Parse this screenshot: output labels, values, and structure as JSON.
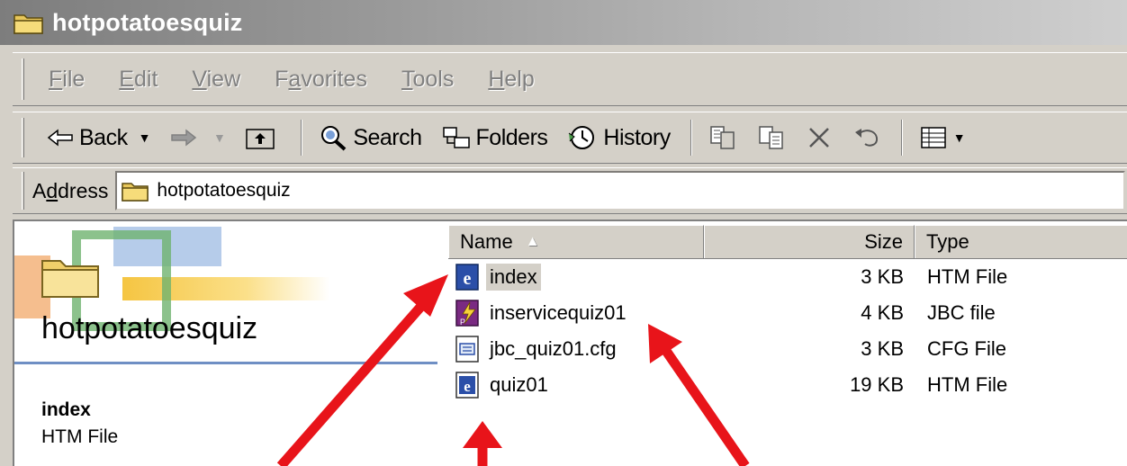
{
  "window": {
    "title": "hotpotatoesquiz"
  },
  "menu": {
    "items": [
      {
        "key": "F",
        "rest": "ile"
      },
      {
        "key": "E",
        "rest": "dit"
      },
      {
        "key": "V",
        "rest": "iew"
      },
      {
        "pre": "F",
        "key": "a",
        "rest": "vorites"
      },
      {
        "key": "T",
        "rest": "ools"
      },
      {
        "key": "H",
        "rest": "elp"
      }
    ]
  },
  "toolbar": {
    "back_label": "Back",
    "search_label": "Search",
    "folders_label": "Folders",
    "history_label": "History"
  },
  "address": {
    "label_pre": "A",
    "label_key": "d",
    "label_rest": "dress",
    "value": "hotpotatoesquiz"
  },
  "left_pane": {
    "folder_title": "hotpotatoesquiz",
    "selected_name": "index",
    "selected_type": "HTM File"
  },
  "file_list": {
    "columns": {
      "name": "Name",
      "size": "Size",
      "type": "Type"
    },
    "rows": [
      {
        "name": "index",
        "size": "3 KB",
        "type": "HTM File",
        "icon": "htm-file-icon"
      },
      {
        "name": "inservicequiz01",
        "size": "4 KB",
        "type": "JBC file",
        "icon": "jbc-file-icon"
      },
      {
        "name": "jbc_quiz01.cfg",
        "size": "3 KB",
        "type": "CFG File",
        "icon": "cfg-file-icon"
      },
      {
        "name": "quiz01",
        "size": "19 KB",
        "type": "HTM File",
        "icon": "htm-file-icon"
      }
    ]
  },
  "colors": {
    "annotation_arrow": "#e8141a",
    "selection": "#d4d0c8"
  }
}
